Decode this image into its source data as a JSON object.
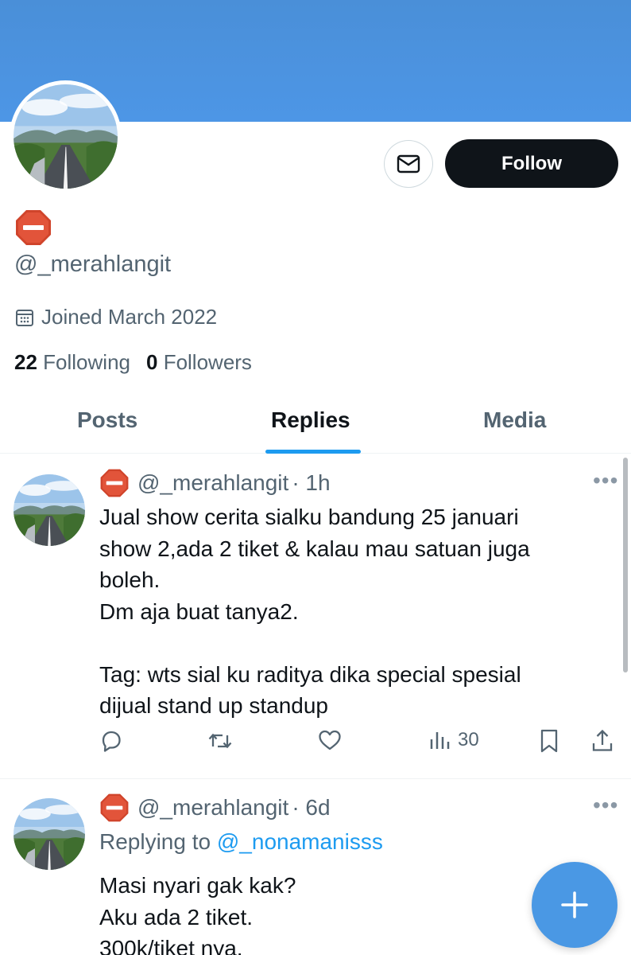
{
  "profile": {
    "handle": "@_merahlangit",
    "joined": "Joined March 2022",
    "following_count": "22",
    "following_label": "Following",
    "followers_count": "0",
    "followers_label": "Followers",
    "follow_label": "Follow",
    "banner_color": "#4a8fd8"
  },
  "tabs": [
    {
      "label": "Posts",
      "active": false
    },
    {
      "label": "Replies",
      "active": true
    },
    {
      "label": "Media",
      "active": false
    }
  ],
  "posts": [
    {
      "handle": "@_merahlangit",
      "time": "· 1h",
      "text": "Jual show cerita sialku bandung 25 januari\nshow 2,ada 2 tiket & kalau mau satuan juga\nboleh.\nDm aja buat tanya2.\n\nTag: wts sial ku raditya dika special spesial\ndijual stand up standup",
      "views": "30"
    },
    {
      "handle": "@_merahlangit",
      "time": "· 6d",
      "replying_prefix": "Replying to ",
      "replying_to": "@_nonamanisss",
      "text": "Masi nyari gak kak?\nAku ada 2 tiket.\n300k/tiket nya."
    }
  ],
  "icons": {
    "message": "envelope-icon",
    "calendar": "calendar-icon",
    "reply": "reply-icon",
    "repost": "repost-icon",
    "like": "heart-icon",
    "views": "views-icon",
    "bookmark": "bookmark-icon",
    "share": "share-icon",
    "more": "more-icon",
    "compose": "plus-icon",
    "stop_emoji": "stop-sign-emoji"
  },
  "colors": {
    "accent": "#1d9bf0",
    "follow_bg": "#0f1419",
    "fab": "#4a98e4"
  }
}
